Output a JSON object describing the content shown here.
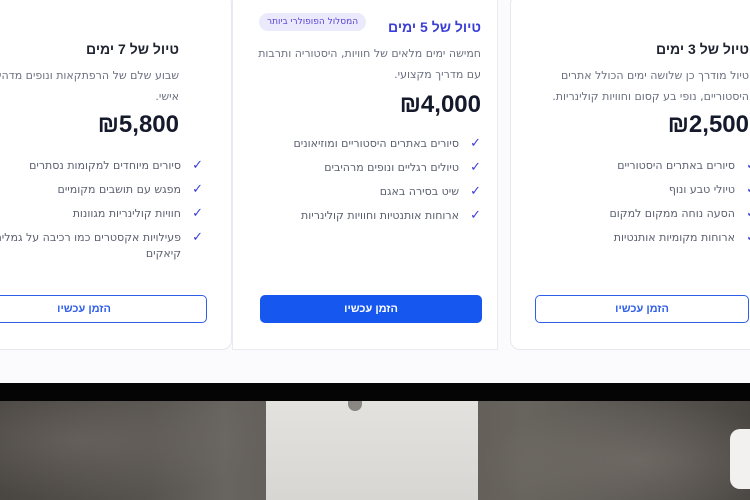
{
  "plans": [
    {
      "id": "7days",
      "title": "טיול של 7 ימים",
      "description": "שבוע שלם של הרפתקאות ונופים מדהימים עם מדריך אישי.",
      "price": "₪5,800",
      "features": [
        "סיורים מיוחדים למקומות נסתרים",
        "מפגש עם תושבים מקומיים",
        "חוויות קולינריות מגוונות",
        "פעילויות אקסטרים כמו רכיבה על גמלים ושייט קיאקים"
      ],
      "cta": "הזמן עכשיו"
    },
    {
      "id": "5days",
      "title": "טיול של 5 ימים",
      "badge": "המסלול הפופולרי ביותר",
      "description": "חמישה ימים מלאים של חוויות, היסטוריה ותרבות עם מדריך מקצועי.",
      "price": "₪4,000",
      "features": [
        "סיורים באתרים היסטוריים ומוזיאונים",
        "טיולים רגליים ונופים מרהיבים",
        "שיט בסירה באגם",
        "ארוחות אותנטיות וחוויות קולינריות"
      ],
      "cta": "הזמן עכשיו"
    },
    {
      "id": "3days",
      "title": "טיול של 3 ימים",
      "description": "טיול מודרך כן שלושה ימים הכולל אתרים היסטוריים, נופי בע קסום וחוויות קולינריות.",
      "price": "₪2,500",
      "features": [
        "סיורים באתרים היסטוריים",
        "טיולי טבע ונוף",
        "הסעה נוחה ממקום למקום",
        "ארוחות מקומיות אותנטיות"
      ],
      "cta": "הזמן עכשיו"
    }
  ],
  "colors": {
    "accent": "#3a3ed6",
    "button": "#1657f0",
    "badge_bg": "#ebeafc"
  }
}
